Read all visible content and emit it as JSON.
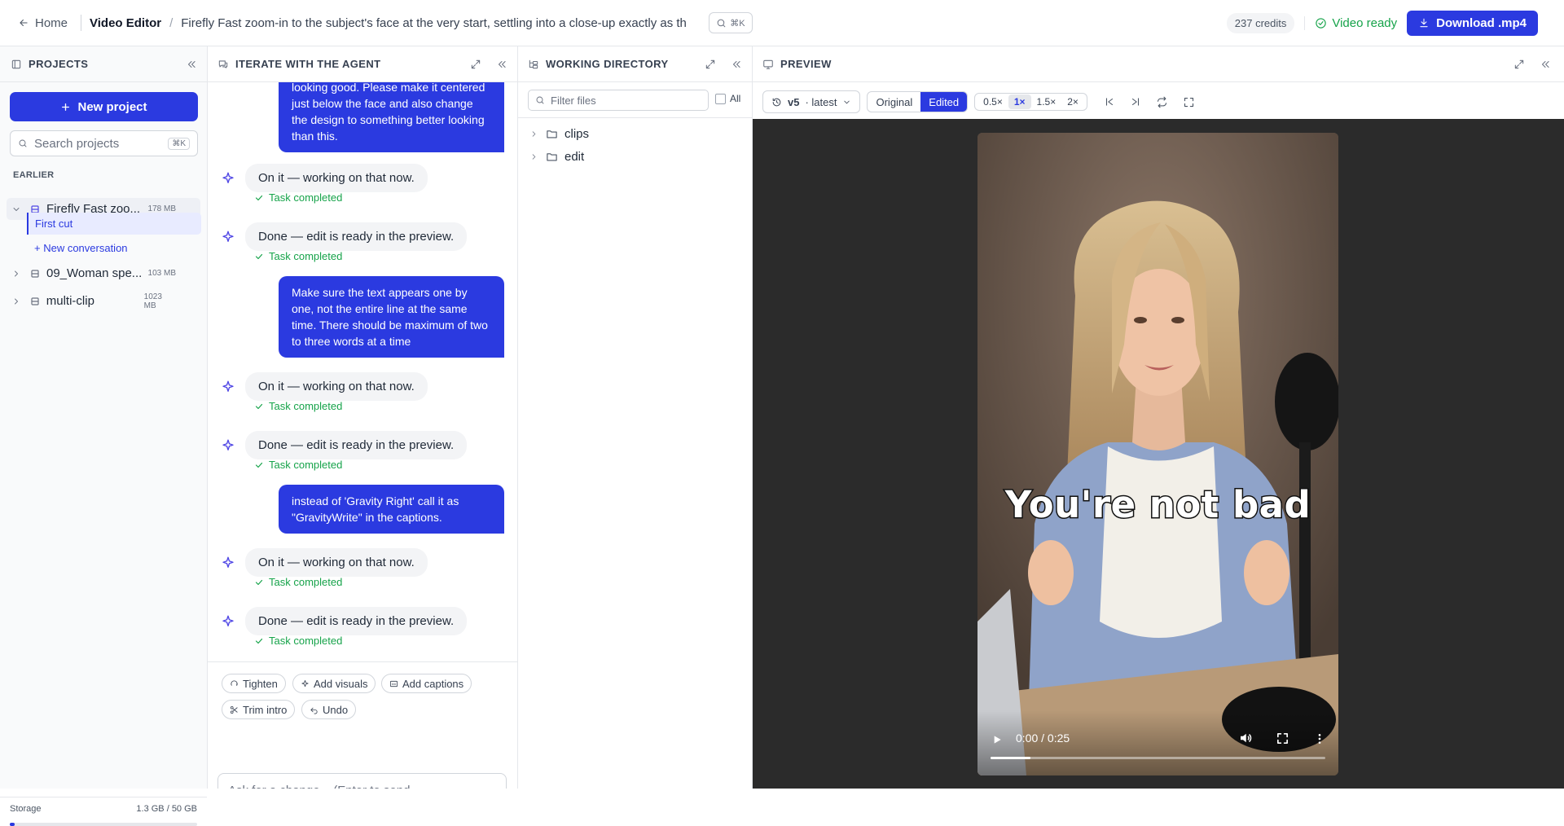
{
  "topbar": {
    "home": "Home",
    "app": "Video Editor",
    "separator": "/",
    "project_title": "Firefly Fast zoom-in to the subject's face at the very start, settling into a close-up exactly as th",
    "search_kbd": "⌘K",
    "credits": "237 credits",
    "status": "Video ready",
    "download": "Download .mp4",
    "status_color": "#16a34a",
    "accent_color": "#2b3ae0"
  },
  "projects": {
    "header": "PROJECTS",
    "new_project": "New project",
    "search_placeholder": "Search projects",
    "search_kbd": "⌘K",
    "section": "EARLIER",
    "items": [
      {
        "name": "Firefly Fast zoo...",
        "size": "178 MB"
      },
      {
        "name": "09_Woman spe...",
        "size": "103 MB"
      },
      {
        "name": "multi-clip",
        "size": "1023 MB"
      }
    ],
    "sub_items": [
      "First cut",
      "+ New conversation"
    ],
    "storage_label": "Storage",
    "storage_value": "1.3 GB / 50 GB",
    "storage_fraction": 0.026
  },
  "chat": {
    "header": "ITERATE WITH THE AGENT",
    "user_messages": [
      "looking good. Please make it centered just below the face and also change the design to something better looking than this.",
      "Make sure the text appears one by one, not the entire line at the same time. There should be maximum of two to three words at a time",
      "instead of 'Gravity Right' call it as \"GravityWrite\" in the captions."
    ],
    "agent_working": "On it — working on that now.",
    "agent_done": "Done — edit is ready in the preview.",
    "task_completed": "Task completed",
    "chips": [
      "Tighten",
      "Add visuals",
      "Add captions",
      "Trim intro",
      "Undo"
    ],
    "composer_placeholder": "Ask for a change...  (Enter to send, Shift+Enter for a new line)"
  },
  "working_directory": {
    "header": "WORKING DIRECTORY",
    "filter_placeholder": "Filter files",
    "all_label": "All",
    "folders": [
      "clips",
      "edit"
    ]
  },
  "preview": {
    "header": "PREVIEW",
    "version": "v5",
    "version_note": "· latest",
    "modes": [
      "Original",
      "Edited"
    ],
    "active_mode": "Edited",
    "speeds": [
      "0.5×",
      "1×",
      "1.5×",
      "2×"
    ],
    "active_speed": "1×",
    "caption": "You're not bad",
    "time": "0:00 / 0:25",
    "progress_fraction": 0.12
  }
}
